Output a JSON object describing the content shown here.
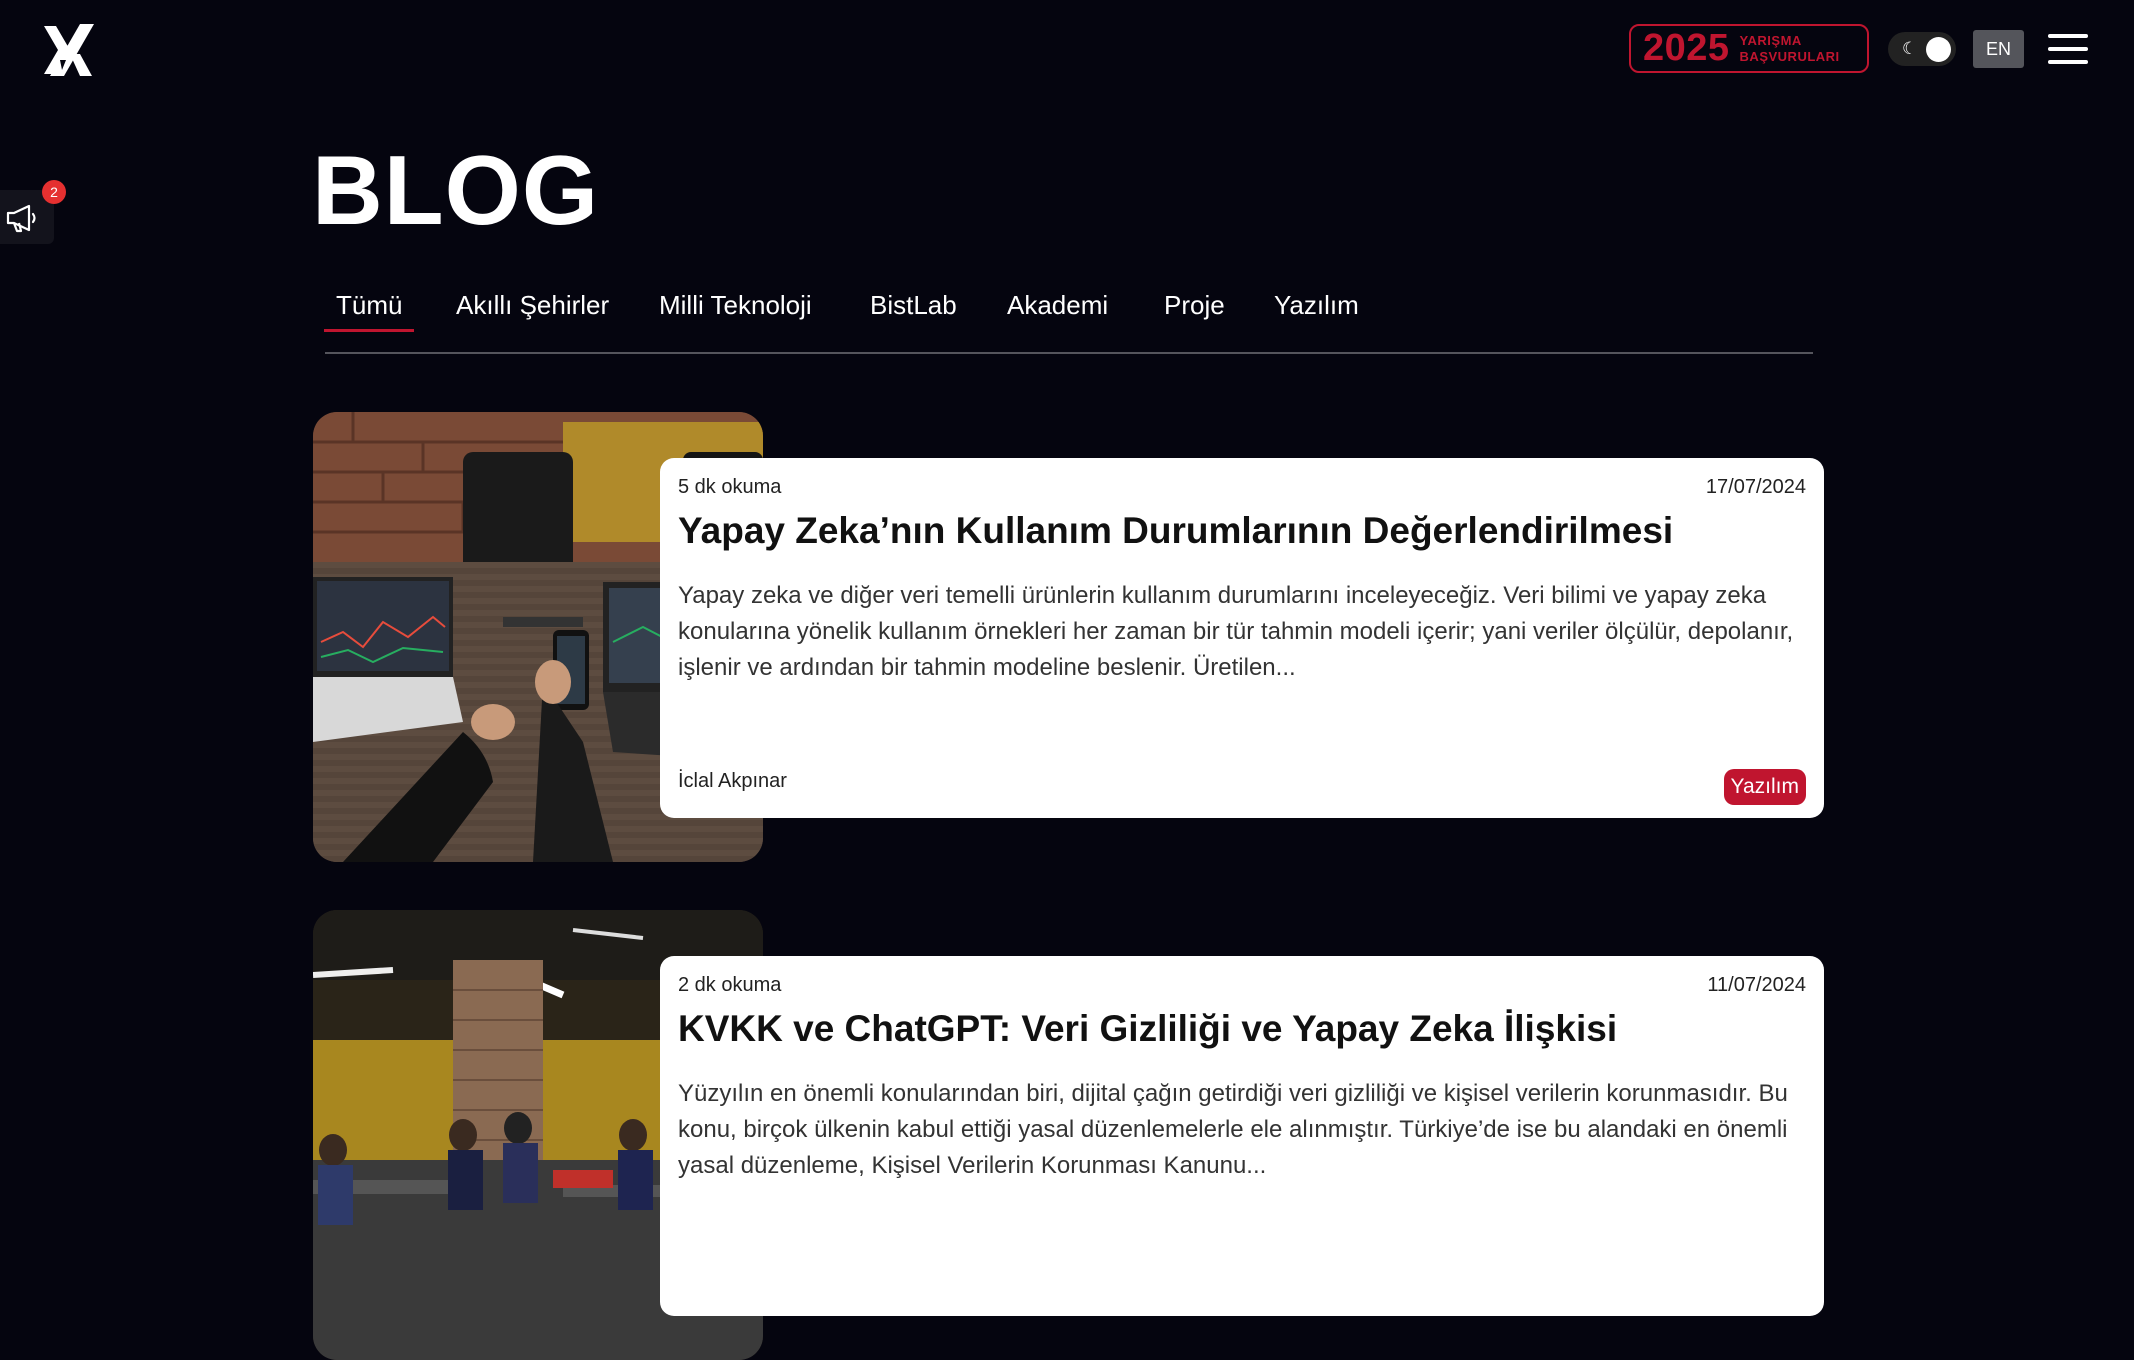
{
  "header": {
    "cta_year": "2025",
    "cta_line1": "YARIŞMA",
    "cta_line2": "BAŞVURULARI",
    "lang_label": "EN"
  },
  "announcement": {
    "count": "2"
  },
  "page": {
    "title": "BLOG"
  },
  "tabs": [
    {
      "label": "Tümü",
      "active": true
    },
    {
      "label": "Akıllı Şehirler"
    },
    {
      "label": "Milli Teknoloji"
    },
    {
      "label": "BistLab"
    },
    {
      "label": "Akademi"
    },
    {
      "label": "Proje"
    },
    {
      "label": "Yazılım"
    }
  ],
  "posts": [
    {
      "read_time": "5 dk okuma",
      "date": "17/07/2024",
      "title": "Yapay Zeka’nın Kullanım Durumlarının Değerlendirilmesi",
      "excerpt": "Yapay zeka ve diğer veri temelli ürünlerin kullanım durumlarını inceleyeceğiz. Veri bilimi ve yapay zeka konularına yönelik kullanım örnekleri her zaman bir tür tahmin modeli içerir; yani veriler ölçülür, depolanır, işlenir ve ardından bir tahmin modeline beslenir. Üretilen...",
      "author": "İclal Akpınar",
      "category": "Yazılım"
    },
    {
      "read_time": "2 dk okuma",
      "date": "11/07/2024",
      "title": "KVKK ve ChatGPT: Veri Gizliliği ve Yapay Zeka İlişkisi",
      "excerpt": "Yüzyılın en önemli konularından biri, dijital çağın getirdiği veri gizliliği ve kişisel verilerin korunmasıdır. Bu konu, birçok ülkenin kabul ettiği yasal düzenlemelerle ele alınmıştır. Türkiye’de ise bu alandaki en önemli yasal düzenleme, Kişisel Verilerin Korunması Kanunu..."
    }
  ],
  "colors": {
    "background": "#05050f",
    "accent": "#c0152f",
    "card": "#ffffff"
  }
}
